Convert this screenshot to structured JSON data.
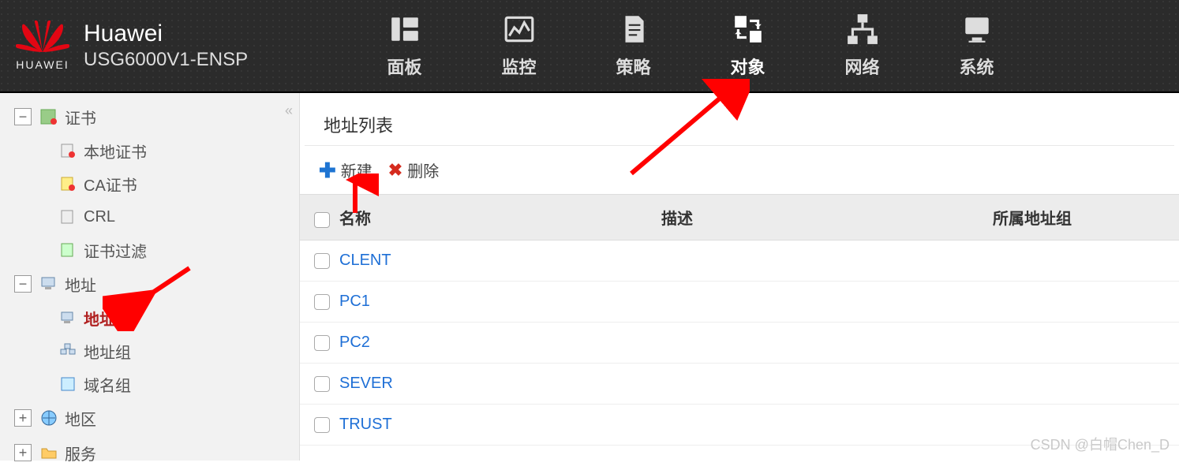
{
  "header": {
    "brand_top": "Huawei",
    "brand_sub": "USG6000V1-ENSP",
    "logo_label": "HUAWEI",
    "nav": [
      {
        "label": "面板",
        "icon": "panel"
      },
      {
        "label": "监控",
        "icon": "monitor"
      },
      {
        "label": "策略",
        "icon": "policy"
      },
      {
        "label": "对象",
        "icon": "object",
        "active": true
      },
      {
        "label": "网络",
        "icon": "network"
      },
      {
        "label": "系统",
        "icon": "system"
      }
    ]
  },
  "sidebar": {
    "nodes": [
      {
        "label": "证书",
        "expanded": true,
        "children": [
          {
            "label": "本地证书"
          },
          {
            "label": "CA证书"
          },
          {
            "label": "CRL"
          },
          {
            "label": "证书过滤"
          }
        ]
      },
      {
        "label": "地址",
        "expanded": true,
        "children": [
          {
            "label": "地址",
            "active": true
          },
          {
            "label": "地址组"
          },
          {
            "label": "域名组"
          }
        ]
      },
      {
        "label": "地区",
        "expanded": false
      },
      {
        "label": "服务",
        "expanded": false
      }
    ]
  },
  "main": {
    "title": "地址列表",
    "toolbar": {
      "new_label": "新建",
      "delete_label": "删除"
    },
    "columns": {
      "name": "名称",
      "desc": "描述",
      "group": "所属地址组"
    },
    "rows": [
      {
        "name": "CLENT",
        "desc": "",
        "group": ""
      },
      {
        "name": "PC1",
        "desc": "",
        "group": ""
      },
      {
        "name": "PC2",
        "desc": "",
        "group": ""
      },
      {
        "name": "SEVER",
        "desc": "",
        "group": ""
      },
      {
        "name": "TRUST",
        "desc": "",
        "group": ""
      }
    ]
  },
  "watermark": "CSDN @白帽Chen_D"
}
